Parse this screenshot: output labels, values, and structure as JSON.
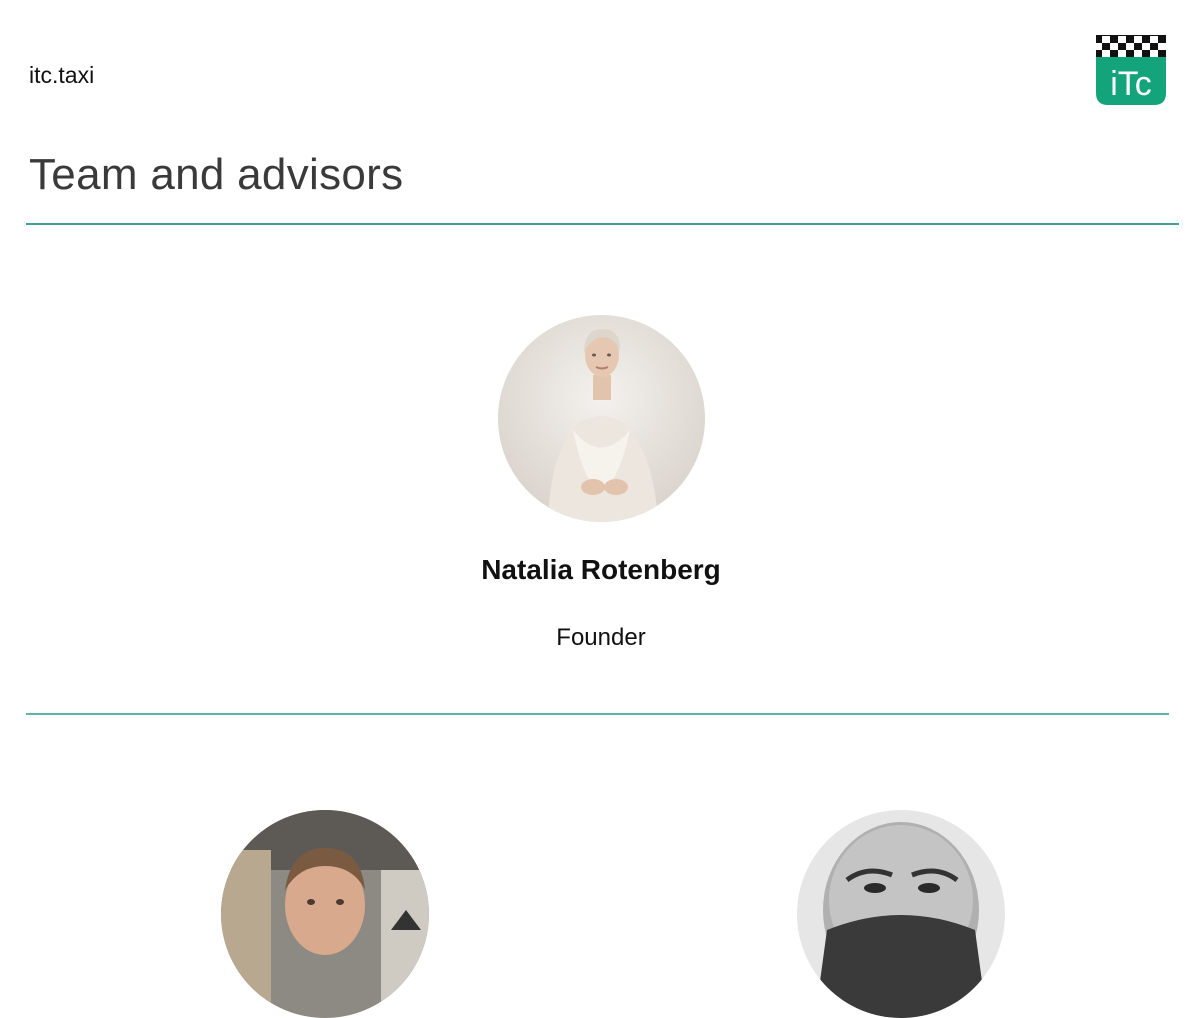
{
  "header": {
    "site_name": "itc.taxi",
    "logo_text": "iTc",
    "logo_icon": "checkered-taxi-logo",
    "brand_color": "#14a47c"
  },
  "section": {
    "title": "Team and advisors",
    "accent_color": "#3aa394"
  },
  "founder": {
    "name": "Natalia Rotenberg",
    "role": "Founder",
    "photo": "portrait-woman-white-outfit"
  },
  "members": [
    {
      "photo": "portrait-man-restaurant"
    },
    {
      "photo": "portrait-bald-bearded-man-bw"
    }
  ]
}
